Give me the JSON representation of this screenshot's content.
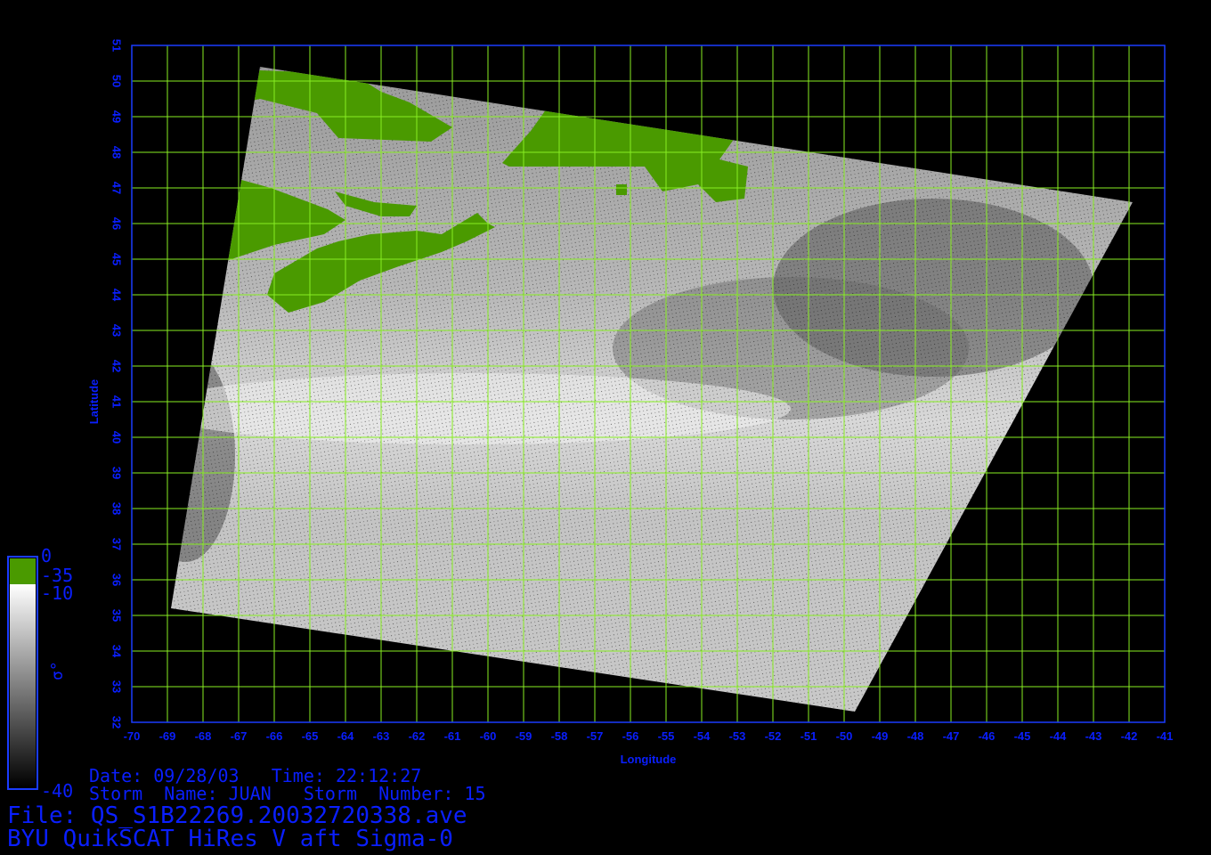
{
  "colors": {
    "background": "#000000",
    "frame": "#1a3cff",
    "grid": "#88ee22",
    "land": "#4a9a00",
    "label": "#0a1fff",
    "ocean_bright": "#e6e6e6",
    "ocean_dark": "#3a3a3a"
  },
  "map": {
    "lon_range": [
      -70,
      -41
    ],
    "lat_range": [
      32,
      51
    ],
    "lon_ticks": [
      "-70",
      "-69",
      "-68",
      "-67",
      "-66",
      "-65",
      "-64",
      "-63",
      "-62",
      "-61",
      "-60",
      "-59",
      "-58",
      "-57",
      "-56",
      "-55",
      "-54",
      "-53",
      "-52",
      "-51",
      "-50",
      "-49",
      "-48",
      "-47",
      "-46",
      "-45",
      "-44",
      "-43",
      "-42",
      "-41"
    ],
    "lat_ticks": [
      "32",
      "33",
      "34",
      "35",
      "36",
      "37",
      "38",
      "39",
      "40",
      "41",
      "42",
      "43",
      "44",
      "45",
      "46",
      "47",
      "48",
      "49",
      "50",
      "51"
    ],
    "xlabel": "Longitude",
    "ylabel": "Latitude",
    "grid": true,
    "swath_corners": [
      [
        -66.4,
        50.4
      ],
      [
        -41.9,
        46.6
      ],
      [
        -49.7,
        32.3
      ],
      [
        -68.9,
        35.2
      ]
    ]
  },
  "colorbar": {
    "label_top": "0",
    "label_upper": "-35",
    "label_mid": "-10",
    "label_bottom": "-40",
    "symbol": "σ°",
    "segments": [
      "land-green",
      "white-to-black-gradient"
    ]
  },
  "annotation": {
    "date_line": "Date: 09/28/03   Time: 22:12:27",
    "storm_line": "Storm  Name: JUAN   Storm  Number: 15",
    "file_line": "File: QS_S1B22269.20032720338.ave",
    "product_line": "BYU QuikSCAT HiRes V aft Sigma-0"
  }
}
